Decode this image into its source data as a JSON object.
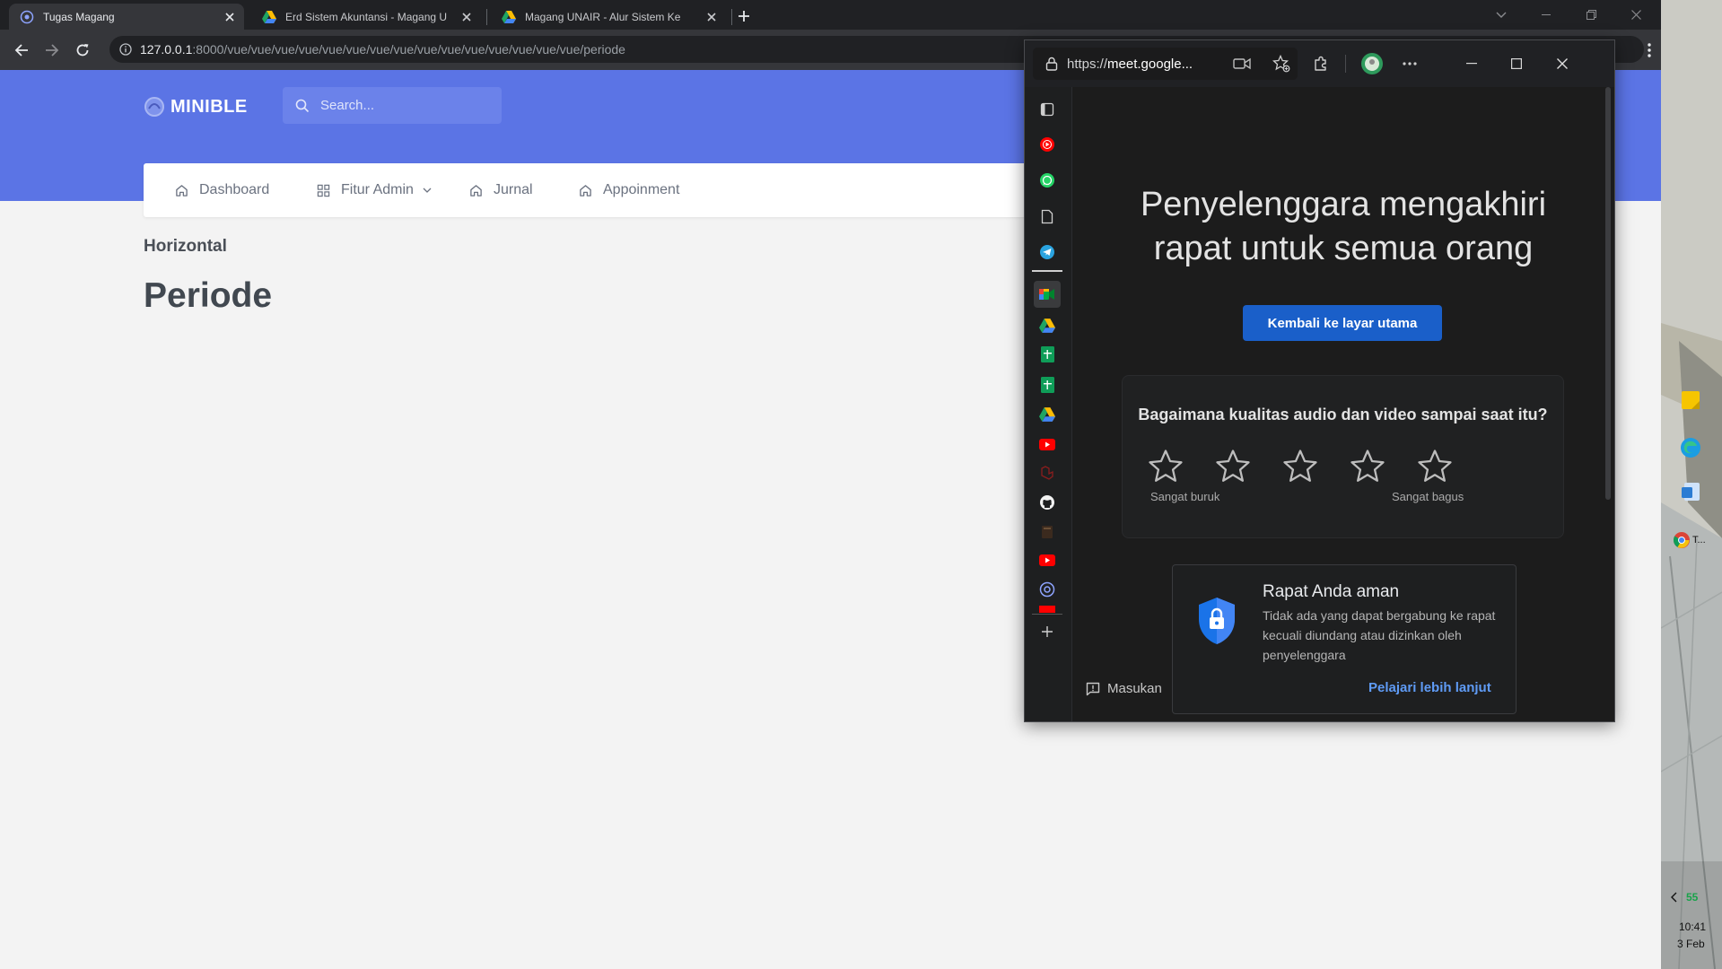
{
  "browser": {
    "tabs": [
      {
        "title": "Tugas Magang",
        "active": true,
        "favicon": "app-gear-icon"
      },
      {
        "title": "Erd Sistem Akuntansi - Magang U",
        "active": false,
        "favicon": "google-drive-icon"
      },
      {
        "title": "Magang UNAIR - Alur Sistem Ke",
        "active": false,
        "favicon": "google-drive-icon"
      }
    ],
    "url": {
      "host": "127.0.0.1",
      "rest": ":8000/vue/vue/vue/vue/vue/vue/vue/vue/vue/vue/vue/vue/vue/vue/vue/periode"
    }
  },
  "app": {
    "brand": "MINIBLE",
    "search_placeholder": "Search...",
    "nav": [
      {
        "label": "Dashboard",
        "icon": "home-icon"
      },
      {
        "label": "Fitur Admin",
        "icon": "grid-icon",
        "dropdown": true
      },
      {
        "label": "Jurnal",
        "icon": "home-icon"
      },
      {
        "label": "Appoinment",
        "icon": "home-icon"
      }
    ],
    "breadcrumb": "Horizontal",
    "page_title": "Periode",
    "accent_color": "#5b74e5"
  },
  "meet_popup": {
    "url_prefix": "https://",
    "url_host": "meet.google...",
    "heading_line1": "Penyelenggara mengakhiri",
    "heading_line2": "rapat untuk semua orang",
    "return_button": "Kembali ke layar utama",
    "rating_question": "Bagaimana kualitas audio dan video sampai saat itu?",
    "rating_stars": 5,
    "rating_low_label": "Sangat buruk",
    "rating_high_label": "Sangat bagus",
    "secure_title": "Rapat Anda aman",
    "secure_body": "Tidak ada yang dapat bergabung ke rapat kecuali diundang atau dizinkan oleh penyelenggara",
    "learn_more": "Pelajari lebih lanjut",
    "feedback_label": "Masukan",
    "primary_color": "#1a5fc9"
  },
  "desktop": {
    "battery": "55",
    "time": "10:41",
    "date": "3 Feb",
    "taskbar_label": "T..."
  }
}
